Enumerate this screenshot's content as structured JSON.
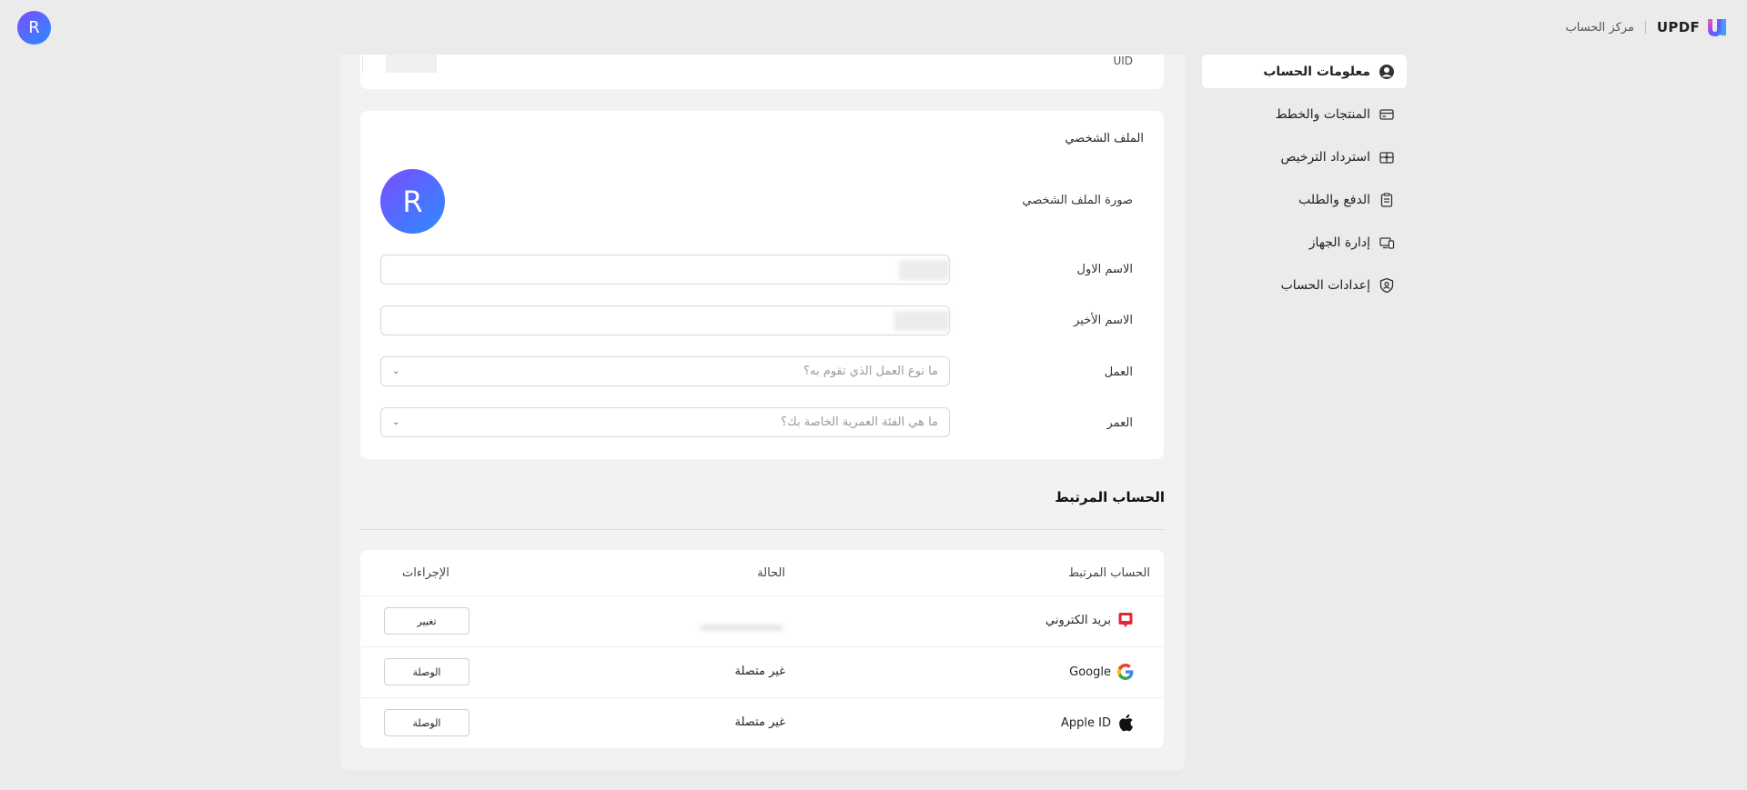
{
  "header": {
    "user_initial": "R",
    "brand_name": "UPDF",
    "center_label": "مركز الحساب"
  },
  "sidebar": {
    "items": [
      {
        "label": "معلومات الحساب",
        "icon": "user-circle-icon",
        "active": true
      },
      {
        "label": "المنتجات والخطط",
        "icon": "card-icon",
        "active": false
      },
      {
        "label": "استرداد الترخيص",
        "icon": "gift-icon",
        "active": false
      },
      {
        "label": "الدفع والطلب",
        "icon": "clipboard-icon",
        "active": false
      },
      {
        "label": "إدارة الجهاز",
        "icon": "devices-icon",
        "active": false
      },
      {
        "label": "إعدادات الحساب",
        "icon": "shield-user-icon",
        "active": false
      }
    ]
  },
  "uid": {
    "label": "UID"
  },
  "profile": {
    "title": "الملف الشخصي",
    "picture_label": "صورة الملف الشخصي",
    "avatar_initial": "R",
    "first_name_label": "الاسم الاول",
    "last_name_label": "الاسم الأخير",
    "job_label": "العمل",
    "job_placeholder": "ما نوع العمل الذي تقوم به؟",
    "age_label": "العمر",
    "age_placeholder": "ما هي الفئة العمرية الخاصة بك؟"
  },
  "linked": {
    "title": "الحساب المرتبط",
    "columns": [
      "الحساب المرتبط",
      "الحالة",
      "الإجراءات"
    ],
    "rows": [
      {
        "account": "بريد الكتروني",
        "icon": "email-icon",
        "status": "",
        "action": "تغيير"
      },
      {
        "account": "Google",
        "icon": "google-icon",
        "status": "غير متصلة",
        "action": "الوصلة"
      },
      {
        "account": "Apple ID",
        "icon": "apple-icon",
        "status": "غير متصلة",
        "action": "الوصلة"
      }
    ]
  },
  "colors": {
    "accent_start": "#7a4dff",
    "accent_end": "#2a8cff",
    "background": "#ebebeb"
  }
}
